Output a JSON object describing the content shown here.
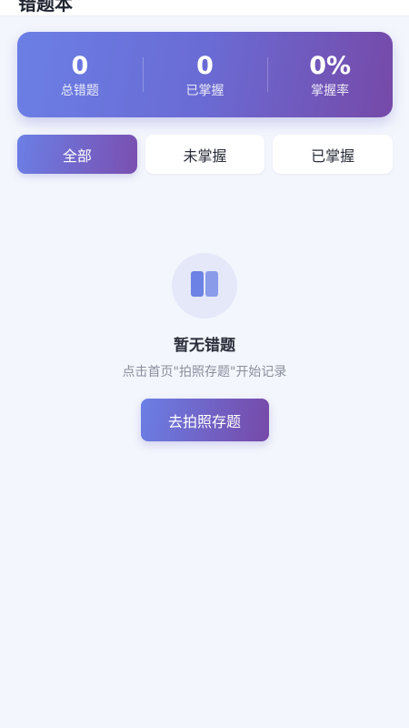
{
  "header": {
    "title": "错题本"
  },
  "stats": [
    {
      "value": "0",
      "label": "总错题"
    },
    {
      "value": "0",
      "label": "已掌握"
    },
    {
      "value": "0%",
      "label": "掌握率"
    }
  ],
  "filter_tabs": [
    {
      "label": "全部",
      "active": true
    },
    {
      "label": "未掌握",
      "active": false
    },
    {
      "label": "已掌握",
      "active": false
    }
  ],
  "empty_state": {
    "icon": "book-icon",
    "title": "暂无错题",
    "description": "点击首页\"拍照存题\"开始记录",
    "button_label": "去拍照存题"
  },
  "colors": {
    "background": "#f4f6fd",
    "accent_start": "#6b7fe5",
    "accent_end": "#7649a8",
    "icon_fill": "#6c82e4",
    "icon_circle": "#e4e8f9"
  }
}
